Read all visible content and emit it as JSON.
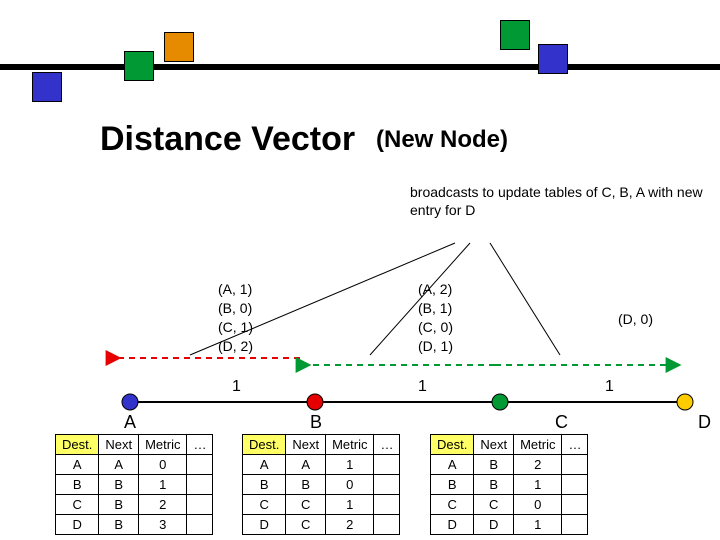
{
  "title_main": "Distance Vector",
  "title_sub": "(New Node)",
  "description": "broadcasts to update tables of C, B, A with new entry for D",
  "logo_colors": {
    "green": "#009933",
    "orange": "#e68a00",
    "blue": "#3333cc"
  },
  "node_colors": {
    "A": "#3333cc",
    "B": "#e60000",
    "C": "#009933",
    "D": "#ffcc00"
  },
  "nodes": {
    "A": "A",
    "B": "B",
    "C": "C",
    "D": "D"
  },
  "edge_labels": {
    "ab": "1",
    "bc": "1",
    "cd": "1"
  },
  "arrow_colors": {
    "left_red": "#e60000",
    "left_green": "#009933",
    "right_green": "#009933"
  },
  "vectors": {
    "B": {
      "l0": "(A, 1)",
      "l1": "(B, 0)",
      "l2": "(C, 1)",
      "l3": "(D, 2)"
    },
    "C": {
      "l0": "(A, 2)",
      "l1": "(B, 1)",
      "l2": "(C, 0)",
      "l3": "(D, 1)"
    },
    "D": {
      "l0": "(D, 0)"
    }
  },
  "headers": {
    "dest": "Dest.",
    "next": "Next",
    "metric": "Metric",
    "more": "…"
  },
  "tables": {
    "A": {
      "r0": {
        "dest": "A",
        "next": "A",
        "metric": "0",
        "more": ""
      },
      "r1": {
        "dest": "B",
        "next": "B",
        "metric": "1",
        "more": ""
      },
      "r2": {
        "dest": "C",
        "next": "B",
        "metric": "2",
        "more": ""
      },
      "r3": {
        "dest": "D",
        "next": "B",
        "metric": "3",
        "more": ""
      }
    },
    "B": {
      "r0": {
        "dest": "A",
        "next": "A",
        "metric": "1",
        "more": ""
      },
      "r1": {
        "dest": "B",
        "next": "B",
        "metric": "0",
        "more": ""
      },
      "r2": {
        "dest": "C",
        "next": "C",
        "metric": "1",
        "more": ""
      },
      "r3": {
        "dest": "D",
        "next": "C",
        "metric": "2",
        "more": ""
      }
    },
    "C": {
      "r0": {
        "dest": "A",
        "next": "B",
        "metric": "2",
        "more": ""
      },
      "r1": {
        "dest": "B",
        "next": "B",
        "metric": "1",
        "more": ""
      },
      "r2": {
        "dest": "C",
        "next": "C",
        "metric": "0",
        "more": ""
      },
      "r3": {
        "dest": "D",
        "next": "D",
        "metric": "1",
        "more": ""
      }
    }
  }
}
